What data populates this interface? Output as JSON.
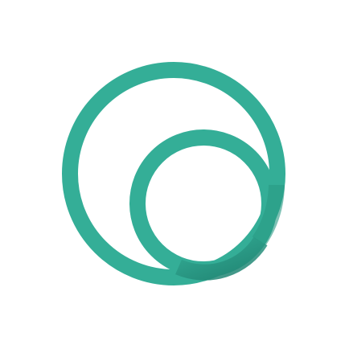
{
  "logo": {
    "name": "concentric-ring-logo",
    "colors": {
      "primary": "#34AE97",
      "shadow": "#1E7F6E",
      "background": "#FFFFFF"
    }
  }
}
